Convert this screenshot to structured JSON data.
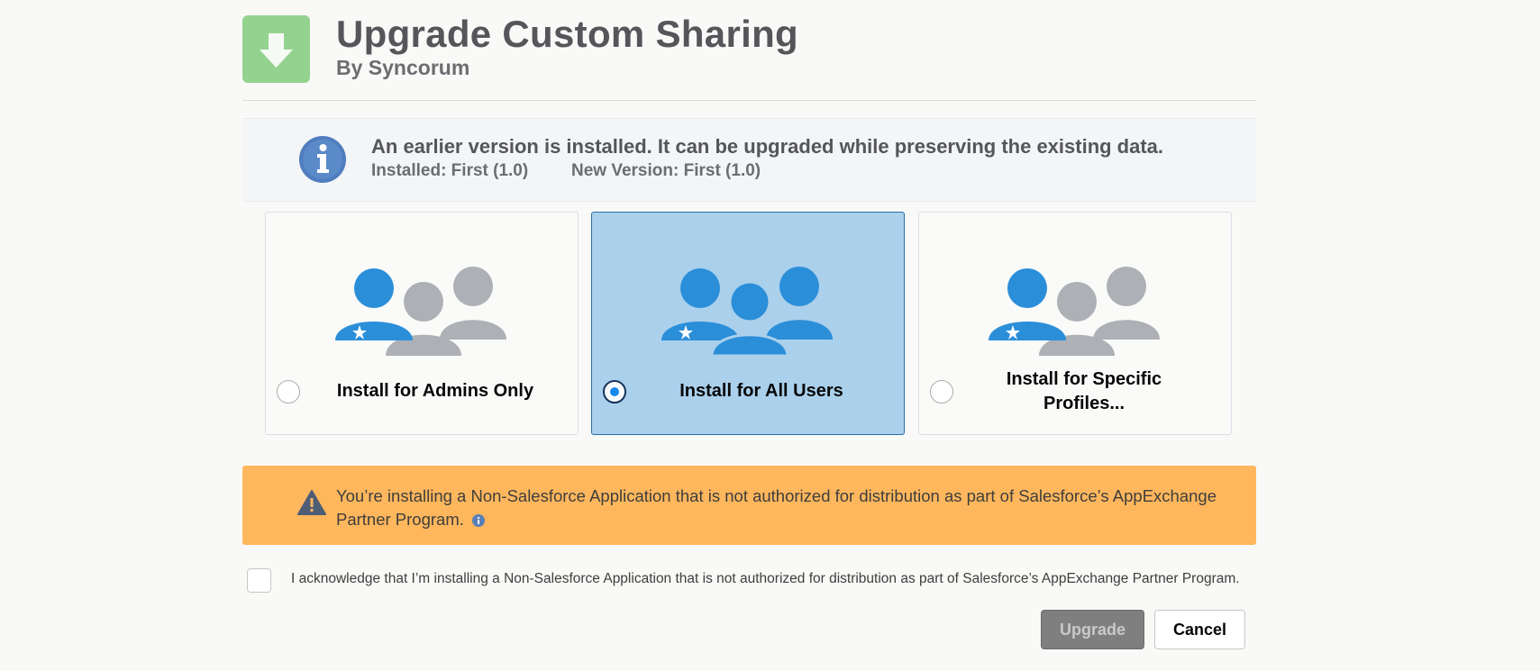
{
  "package": {
    "title": "Upgrade Custom Sharing",
    "byline": "By Syncorum",
    "icon": "download-arrow-icon",
    "icon_color": "#94d38f"
  },
  "info_banner": {
    "message": "An earlier version is installed. It can be upgraded while preserving the existing data.",
    "installed": "Installed: First (1.0)",
    "new_version": "New Version: First (1.0)",
    "icon": "info-icon"
  },
  "install_options": [
    {
      "label": "Install for Admins Only",
      "selected": false
    },
    {
      "label": "Install for All Users",
      "selected": true
    },
    {
      "label": "Install for Specific Profiles...",
      "selected": false
    }
  ],
  "warning": {
    "text": "You’re installing a Non-Salesforce Application that is not authorized for distribution as part of Salesforce’s AppExchange Partner Program.",
    "color": "#ffb75d"
  },
  "acknowledge": {
    "text": "I acknowledge that I’m installing a Non-Salesforce Application that is not authorized for distribution as part of Salesforce’s AppExchange Partner Program.",
    "checked": false
  },
  "buttons": {
    "upgrade": "Upgrade",
    "cancel": "Cancel"
  },
  "colors": {
    "selected_bg": "#aad0ec",
    "user_blue": "#2b8ed9",
    "user_gray": "#adb0b5"
  }
}
